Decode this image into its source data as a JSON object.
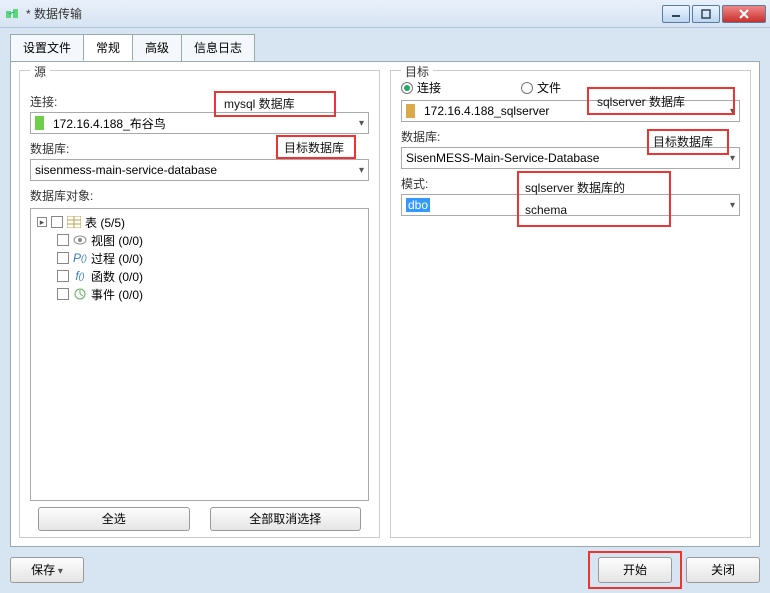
{
  "window": {
    "title": "* 数据传输"
  },
  "tabs": {
    "t0": "设置文件",
    "t1": "常规",
    "t2": "高级",
    "t3": "信息日志"
  },
  "source": {
    "legend": "源",
    "conn_label": "连接:",
    "conn_value": "172.16.4.188_布谷鸟",
    "db_label": "数据库:",
    "db_value": "sisenmess-main-service-database",
    "objects_label": "数据库对象:",
    "tree": {
      "tables": "表  (5/5)",
      "views": "视图  (0/0)",
      "procs": "过程  (0/0)",
      "funcs": "函数  (0/0)",
      "events": "事件  (0/0)"
    },
    "select_all": "全选",
    "deselect_all": "全部取消选择"
  },
  "target": {
    "legend": "目标",
    "radio_conn": "连接",
    "radio_file": "文件",
    "conn_value": "172.16.4.188_sqlserver",
    "db_label": "数据库:",
    "db_value": "SisenMESS-Main-Service-Database",
    "schema_label": "模式:",
    "schema_value": "dbo"
  },
  "annotations": {
    "a1": "mysql 数据库",
    "a2": "目标数据库",
    "a3": "sqlserver 数据库",
    "a4": "目标数据库",
    "a5a": "sqlserver 数据库的",
    "a5b": "schema"
  },
  "bottom": {
    "save": "保存",
    "start": "开始",
    "close": "关闭"
  }
}
